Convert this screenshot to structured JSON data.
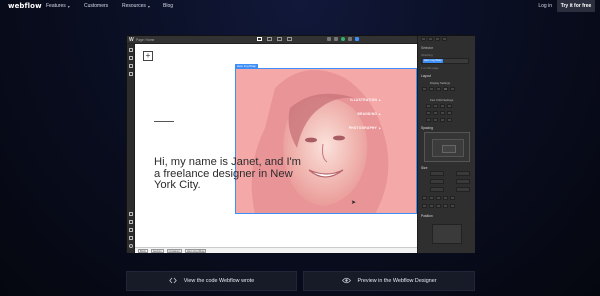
{
  "nav": {
    "logo": "webflow",
    "items": [
      {
        "label": "Features",
        "caret": "▾"
      },
      {
        "label": "Customers",
        "caret": ""
      },
      {
        "label": "Resources",
        "caret": "▾"
      },
      {
        "label": "Blog",
        "caret": ""
      }
    ],
    "login": "Log in",
    "cta": "Try it for free"
  },
  "editor": {
    "logo_letter": "W",
    "page_label": "Page: Home",
    "selection_tag": "Hero Img Wrap",
    "canvas": {
      "plus_symbol": "+",
      "hero_text": "Hi, my name is Janet, and I'm a freelance designer in New York City.",
      "menu": [
        "ILLUSTRATION",
        "BRANDING",
        "PHOTOGRAPHY"
      ],
      "menu_arrow": "▸"
    },
    "breadcrumbs": [
      "Body",
      "Section",
      "Container",
      "Hero Img Wrap"
    ],
    "right_panel": {
      "header": "Selector",
      "inheriting": "Inheriting",
      "class_tag": "Hero Img Wrap",
      "on_this_page": "1 on this page",
      "layout": "Layout",
      "display": "Display Settings",
      "flex": "Flex Child Settings",
      "spacing": "Spacing",
      "size": "Size",
      "position": "Position"
    }
  },
  "cards": [
    {
      "icon": "code-icon",
      "label": "View the code Webflow wrote"
    },
    {
      "icon": "eye-icon",
      "label": "Preview in the Webflow Designer"
    }
  ],
  "colors": {
    "photo_tint": "#f4a8a8",
    "selection_blue": "#3e8ef7",
    "editor_dark": "#2b2b2b",
    "background": "#090d1f"
  }
}
